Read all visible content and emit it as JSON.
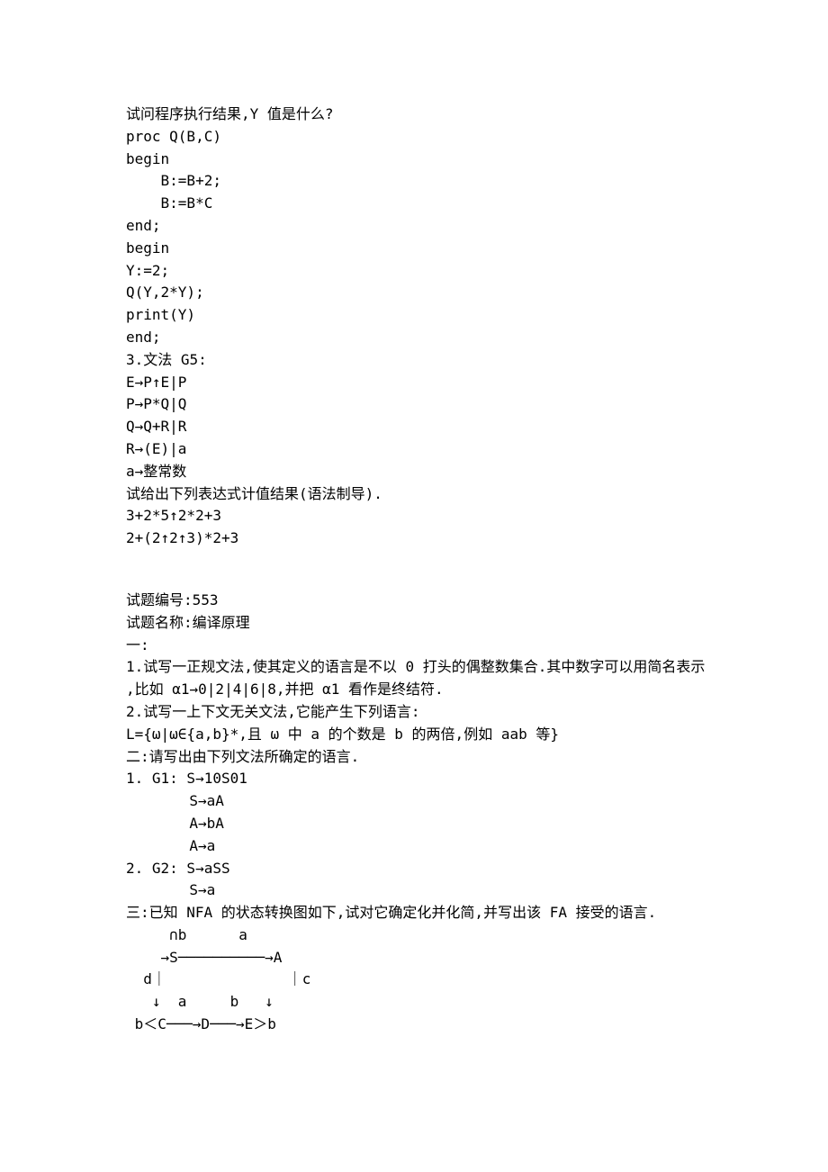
{
  "q2": {
    "prompt": "试问程序执行结果,Y 值是什么?",
    "code": [
      "proc Q(B,C)",
      "begin",
      "    B:=B+2;",
      "    B:=B*C",
      "end;",
      "begin",
      "Y:=2;",
      "Q(Y,2*Y);",
      "print(Y)",
      "end;"
    ]
  },
  "q3": {
    "heading": "3.文法 G5:",
    "grammar": [
      "E→P↑E|P",
      "P→P*Q|Q",
      "Q→Q+R|R",
      "R→(E)|a",
      "a→整常数"
    ],
    "instruction": "试给出下列表达式计值结果(语法制导).",
    "exprs": [
      "3+2*5↑2*2+3",
      "2+(2↑2↑3)*2+3"
    ]
  },
  "meta": {
    "id_label": "试题编号:553",
    "name_label": "试题名称:编译原理"
  },
  "s1": {
    "heading": "一:",
    "items": [
      "1.试写一正规文法,使其定义的语言是不以 0 打头的偶整数集合.其中数字可以用简名表示",
      ",比如 α1→0|2|4|6|8,并把 α1 看作是终结符.",
      "2.试写一上下文无关文法,它能产生下列语言:",
      "L={ω|ω∈{a,b}*,且 ω 中 a 的个数是 b 的两倍,例如 aab 等}"
    ]
  },
  "s2": {
    "heading": "二:请写出由下列文法所确定的语言.",
    "g1_label": "1. G1: S→10S01",
    "g1_lines": [
      "S→aA",
      "A→bA",
      "A→a"
    ],
    "g2_label": "2. G2: S→aSS",
    "g2_lines": [
      "S→a"
    ]
  },
  "s3": {
    "heading": "三:已知 NFA 的状态转换图如下,试对它确定化并化简,并写出该 FA 接受的语言.",
    "diagram": [
      "     ∩b      a",
      "    →S──────────→A",
      "  d｜              ｜c",
      "   ↓  a     b   ↓",
      " b＜C───→D───→E＞b"
    ]
  }
}
